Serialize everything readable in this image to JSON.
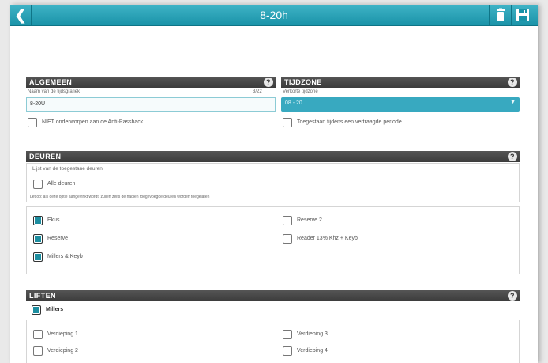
{
  "header": {
    "title": "8-20h",
    "back_icon": "chevron-left-icon",
    "trash_icon": "trash-icon",
    "save_icon": "save-icon",
    "bar_color": "#1a93a8"
  },
  "algemeen": {
    "section_title": "ALGEMEEN",
    "help": "?",
    "name_label": "Naam van de tijdsgrafiek",
    "name_counter": "3/22",
    "name_value": "8-20U",
    "anti_passback_label": "NIET onderworpen aan de Anti-Passback"
  },
  "tijdzone": {
    "section_title": "TIJDZONE",
    "help": "?",
    "select_label": "Verkorte tijdzone",
    "select_value": "08 - 20",
    "chevron": "chevron-down-icon",
    "checkbox_label": "Toegestaan tijdens een vertraagde periode"
  },
  "deuren": {
    "section_title": "DEUREN",
    "help": "?",
    "list_label": "Lijst van de toegestane deuren",
    "all_label": "Alle deuren",
    "note": "Let op: als deze optie aangevinkt wordt, zullen zelfs de nadien toegevoegde deuren worden toegelaten",
    "items": [
      {
        "label": "Ekus",
        "checked": true
      },
      {
        "label": "Reserve 2",
        "checked": false
      },
      {
        "label": "Reserve",
        "checked": true
      },
      {
        "label": "Reader 13% Khz + Keyb",
        "checked": false
      },
      {
        "label": "Millers & Keyb",
        "checked": true
      }
    ]
  },
  "liften": {
    "section_title": "LIFTEN",
    "help": "?",
    "group_label": "Millers",
    "items": [
      {
        "label": "Verdieping 1",
        "checked": false
      },
      {
        "label": "Verdieping 3",
        "checked": false
      },
      {
        "label": "Verdieping 2",
        "checked": false
      },
      {
        "label": "Verdieping 4",
        "checked": false
      }
    ]
  }
}
